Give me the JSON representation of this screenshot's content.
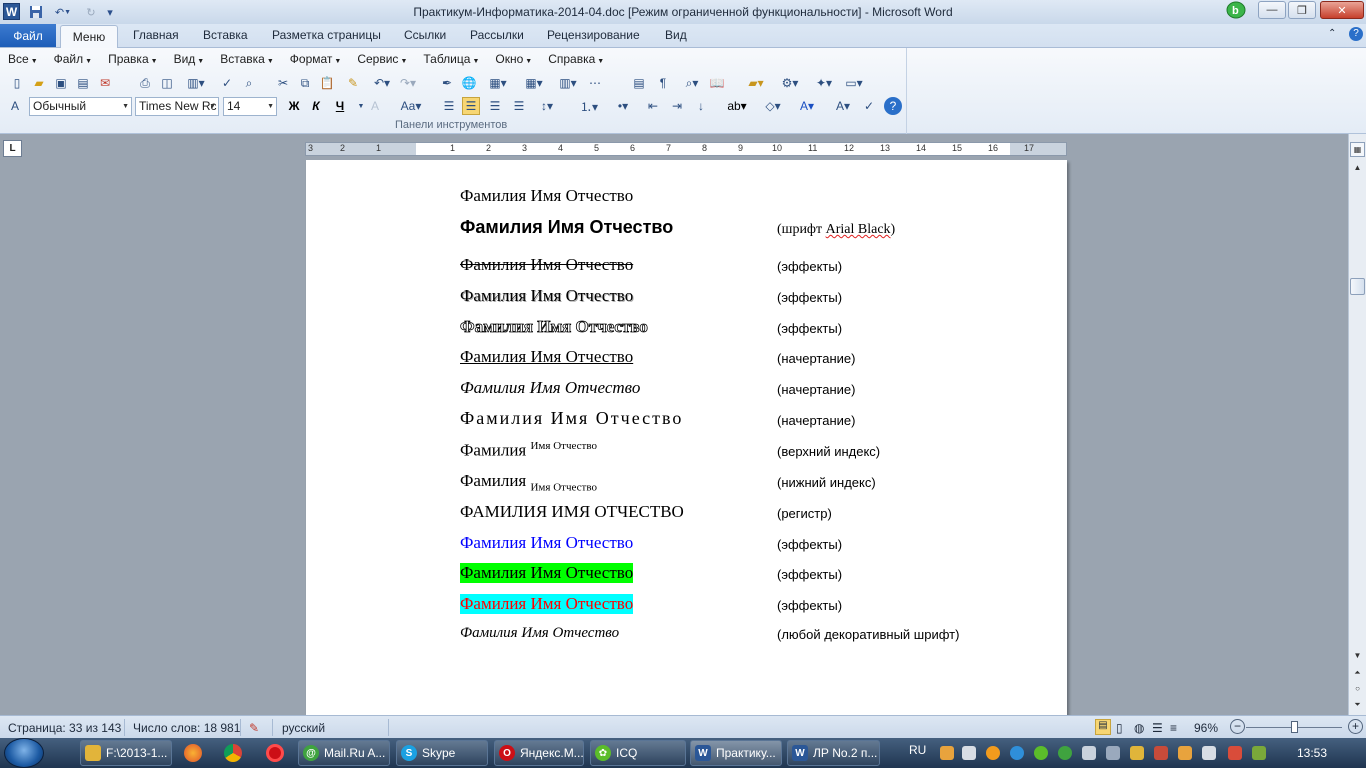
{
  "window": {
    "title": "Практикум-Информатика-2014-04.doc [Режим ограниченной функциональности]  -  Microsoft Word",
    "app_letter": "W"
  },
  "ribbon_tabs": {
    "file": "Файл",
    "tabs": [
      "Меню",
      "Главная",
      "Вставка",
      "Разметка страницы",
      "Ссылки",
      "Рассылки",
      "Рецензирование",
      "Вид"
    ]
  },
  "menu": [
    "Все",
    "Файл",
    "Правка",
    "Вид",
    "Вставка",
    "Формат",
    "Сервис",
    "Таблица",
    "Окно",
    "Справка"
  ],
  "format_toolbar": {
    "style": "Обычный",
    "font": "Times New Rc",
    "size": "14",
    "bold": "Ж",
    "italic": "К",
    "underline": "Ч"
  },
  "ribbon_group_label": "Панели инструментов",
  "ruler": {
    "numbers": [
      "3",
      "2",
      "1",
      "1",
      "2",
      "3",
      "4",
      "5",
      "6",
      "7",
      "8",
      "9",
      "10",
      "11",
      "12",
      "13",
      "14",
      "15",
      "16",
      "17"
    ]
  },
  "document": {
    "lines": [
      {
        "left": "Фамилия Имя Отчество",
        "right": ""
      },
      {
        "left": "Фамилия Имя Отчество",
        "right": "(шрифт Arial Black)"
      },
      {
        "left": "Фамилия Имя Отчество",
        "right": "(эффекты)"
      },
      {
        "left": "Фамилия Имя Отчество",
        "right": "(эффекты)"
      },
      {
        "left": "Фамилия Имя Отчество",
        "right": "(эффекты)"
      },
      {
        "left": "Фамилия Имя Отчество",
        "right": "(начертание)"
      },
      {
        "left": "Фамилия Имя Отчество",
        "right": "(начертание)"
      },
      {
        "left": "Фамилия  Имя  Отчество",
        "right": "(начертание)"
      },
      {
        "left": "Фамилия",
        "left_extra": "Имя Отчество",
        "right": "(верхний индекс)"
      },
      {
        "left": "Фамилия",
        "left_extra": "Имя Отчество",
        "right": "(нижний индекс)"
      },
      {
        "left": "ФАМИЛИЯ ИМЯ ОТЧЕСТВО",
        "right": "(регистр)"
      },
      {
        "left": "Фамилия Имя Отчество",
        "right": "(эффекты)"
      },
      {
        "left": "Фамилия Имя Отчество",
        "right": "(эффекты)"
      },
      {
        "left": "Фамилия Имя Отчество",
        "right": "(эффекты)"
      },
      {
        "left": "Фамилия Имя Отчество",
        "right": "(любой декоративный шрифт)"
      }
    ],
    "colors": {
      "blue_text": "#0000ff",
      "green_highlight": "#00ff00",
      "cyan_highlight": "#00ffff",
      "red_text": "#ff0000"
    }
  },
  "status": {
    "page": "Страница: 33 из 143",
    "words": "Число слов: 18 981",
    "lang": "русский",
    "zoom": "96%"
  },
  "taskbar": {
    "tasks": [
      "F:\\2013-1...",
      "Mail.Ru A...",
      "Skype",
      "Яндекс.М...",
      "ICQ",
      "Практику...",
      "ЛР No.2 п..."
    ],
    "lang": "RU",
    "time": "13:53"
  }
}
